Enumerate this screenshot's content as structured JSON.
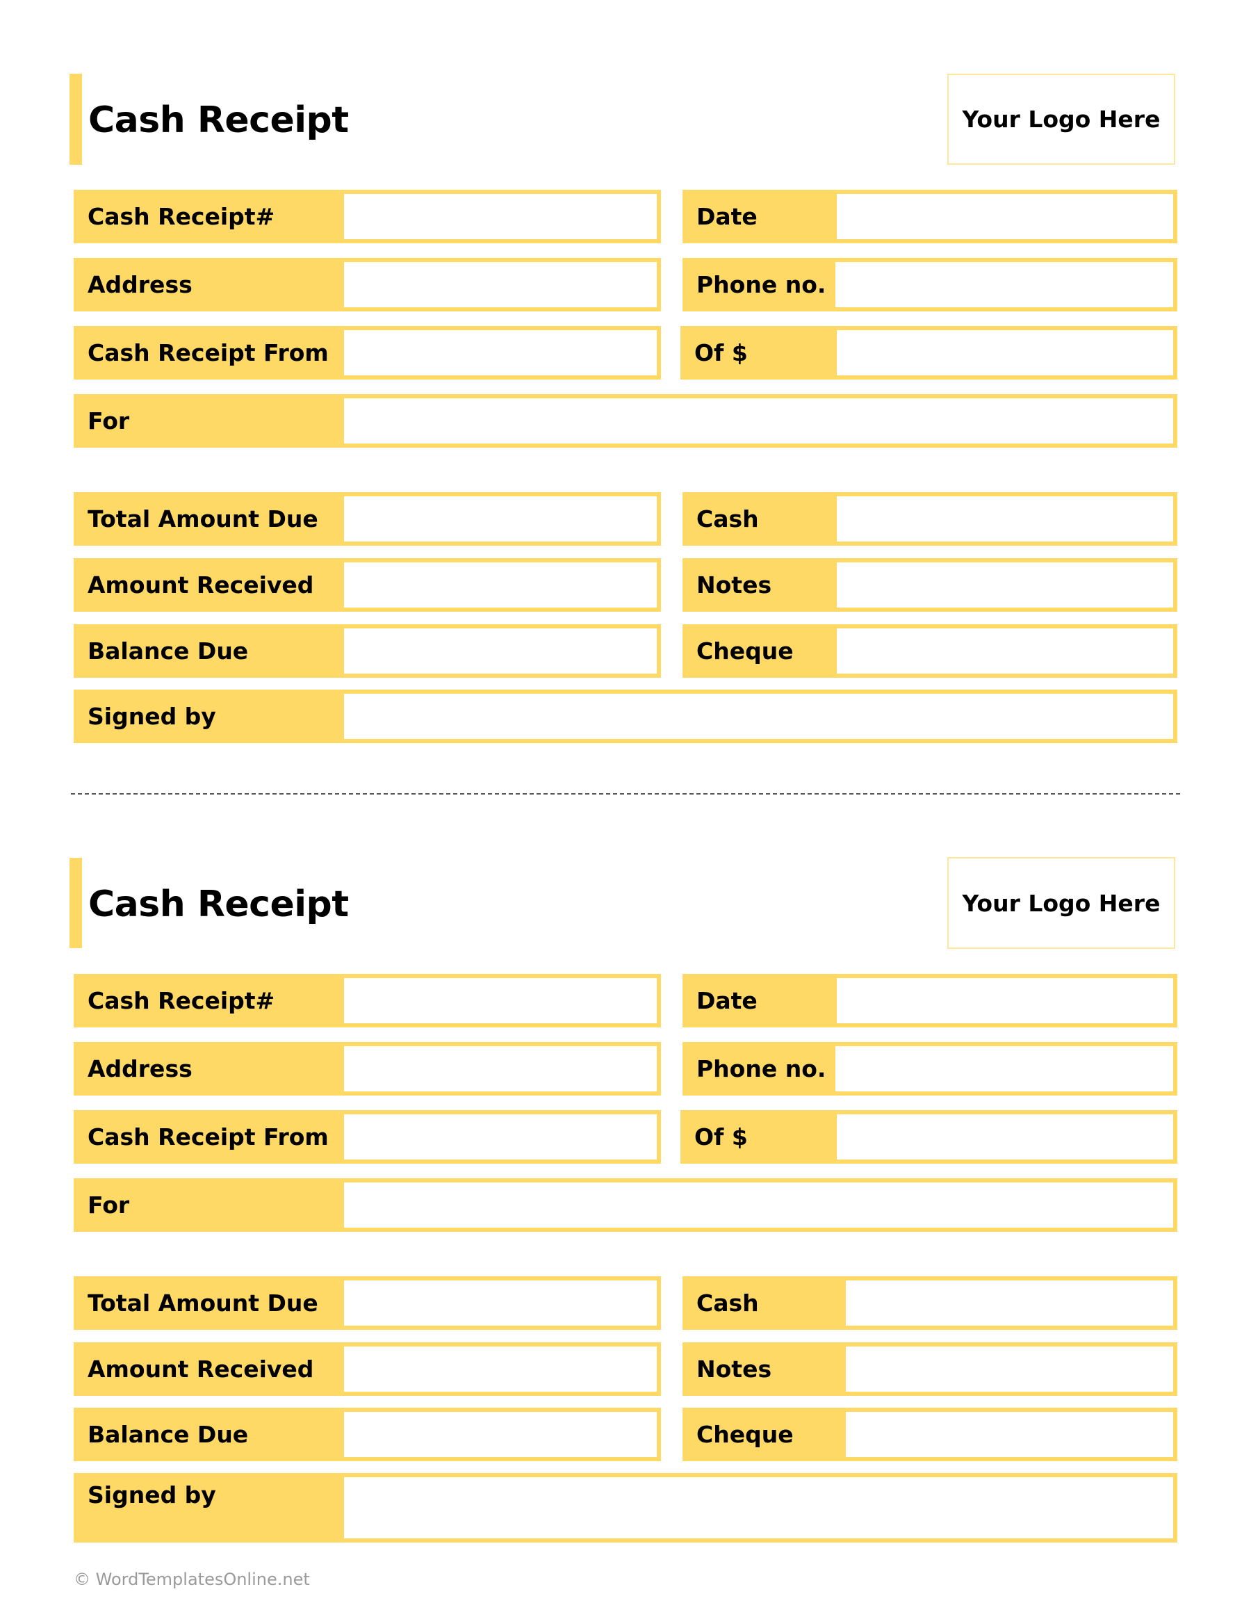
{
  "receipts": [
    {
      "title": "Cash Receipt",
      "logo_text": "Your Logo Here",
      "fields": {
        "receipt_no": {
          "label": "Cash Receipt#",
          "value": ""
        },
        "date": {
          "label": "Date",
          "value": ""
        },
        "address": {
          "label": "Address",
          "value": ""
        },
        "phone": {
          "label": "Phone no.",
          "value": ""
        },
        "received_from": {
          "label": "Cash Receipt From",
          "value": ""
        },
        "of_amount": {
          "label": "Of $",
          "value": ""
        },
        "for": {
          "label": "For",
          "value": ""
        },
        "total_due": {
          "label": "Total Amount Due",
          "value": ""
        },
        "cash": {
          "label": "Cash",
          "value": ""
        },
        "amount_received": {
          "label": "Amount Received",
          "value": ""
        },
        "notes": {
          "label": "Notes",
          "value": ""
        },
        "balance_due": {
          "label": "Balance Due",
          "value": ""
        },
        "cheque": {
          "label": "Cheque",
          "value": ""
        },
        "signed_by": {
          "label": "Signed by",
          "value": ""
        }
      }
    },
    {
      "title": "Cash Receipt",
      "logo_text": "Your Logo Here",
      "fields": {
        "receipt_no": {
          "label": "Cash Receipt#",
          "value": ""
        },
        "date": {
          "label": "Date",
          "value": ""
        },
        "address": {
          "label": "Address",
          "value": ""
        },
        "phone": {
          "label": "Phone no.",
          "value": ""
        },
        "received_from": {
          "label": "Cash Receipt From",
          "value": ""
        },
        "of_amount": {
          "label": "Of $",
          "value": ""
        },
        "for": {
          "label": "For",
          "value": ""
        },
        "total_due": {
          "label": "Total Amount Due",
          "value": ""
        },
        "cash": {
          "label": "Cash",
          "value": ""
        },
        "amount_received": {
          "label": "Amount Received",
          "value": ""
        },
        "notes": {
          "label": "Notes",
          "value": ""
        },
        "balance_due": {
          "label": "Balance Due",
          "value": ""
        },
        "cheque": {
          "label": "Cheque",
          "value": ""
        },
        "signed_by": {
          "label": "Signed by",
          "value": ""
        }
      }
    }
  ],
  "footer": "© WordTemplatesOnline.net",
  "colors": {
    "accent": "#FFD966",
    "logo_border": "#FFE699",
    "footer_text": "#9A9A9A"
  }
}
